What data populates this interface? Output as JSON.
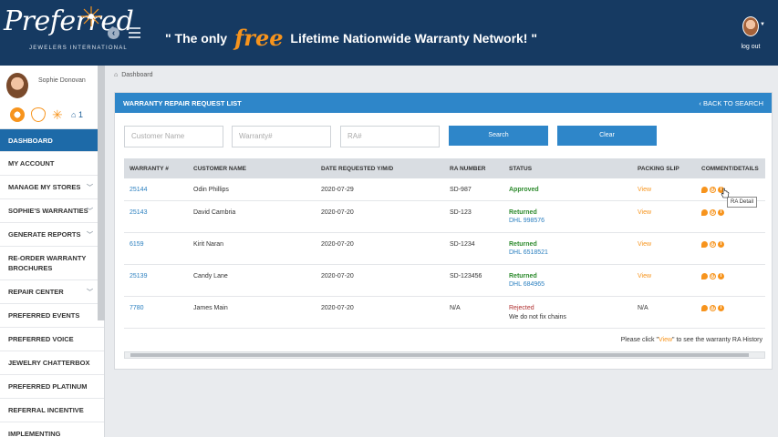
{
  "header": {
    "logo_word": "Preferred",
    "logo_sub": "JEWELERS INTERNATIONAL",
    "slogan_pre": "\" The only",
    "slogan_free": "free",
    "slogan_post": "Lifetime Nationwide Warranty Network! \"",
    "logout_label": "log out",
    "back_icon": "chevron-left-circle-icon",
    "menu_icon": "hamburger-icon"
  },
  "sidebar": {
    "user_name": "Sophie Donovan",
    "home_count": "1",
    "items": [
      {
        "label": "DASHBOARD",
        "active": true,
        "chevron": false
      },
      {
        "label": "MY ACCOUNT",
        "chevron": false
      },
      {
        "label": "MANAGE MY STORES",
        "chevron": true
      },
      {
        "label": "SOPHIE'S WARRANTIES",
        "chevron": true
      },
      {
        "label": "GENERATE REPORTS",
        "chevron": true
      },
      {
        "label": "RE-ORDER WARRANTY BROCHURES",
        "chevron": false
      },
      {
        "label": "REPAIR CENTER",
        "chevron": true
      },
      {
        "label": "PREFERRED EVENTS",
        "chevron": false
      },
      {
        "label": "PREFERRED VOICE",
        "chevron": false
      },
      {
        "label": "JEWELRY CHATTERBOX",
        "chevron": false
      },
      {
        "label": "PREFERRED PLATINUM",
        "chevron": false
      },
      {
        "label": "REFERRAL INCENTIVE",
        "chevron": false
      },
      {
        "label": "IMPLEMENTING",
        "chevron": false
      }
    ]
  },
  "breadcrumb": "Dashboard",
  "panel": {
    "title": "WARRANTY REPAIR REQUEST LIST",
    "back_label": "BACK TO SEARCH",
    "filters": {
      "customer_placeholder": "Customer Name",
      "warranty_placeholder": "Warranty#",
      "ra_placeholder": "RA#",
      "search_label": "Search",
      "clear_label": "Clear"
    },
    "columns": [
      "WARRANTY #",
      "CUSTOMER NAME",
      "DATE REQUESTED Y/M/D",
      "RA NUMBER",
      "STATUS",
      "PACKING SLIP",
      "COMMENT/DETAILS"
    ],
    "rows": [
      {
        "warranty": "25144",
        "customer": "Odin Phillips",
        "date": "2020-07-29",
        "ra": "SD-987",
        "status": "Approved",
        "status_type": "approved",
        "sub": "",
        "slip": "View"
      },
      {
        "warranty": "25143",
        "customer": "David Cambria",
        "date": "2020-07-20",
        "ra": "SD-123",
        "status": "Returned",
        "status_type": "returned",
        "sub": "DHL 998576",
        "slip": "View"
      },
      {
        "warranty": "6159",
        "customer": "Kirit Naran",
        "date": "2020-07-20",
        "ra": "SD-1234",
        "status": "Returned",
        "status_type": "returned",
        "sub": "DHL 6518521",
        "slip": "View"
      },
      {
        "warranty": "25139",
        "customer": "Candy Lane",
        "date": "2020-07-20",
        "ra": "SD-123456",
        "status": "Returned",
        "status_type": "returned",
        "sub": "DHL 684965",
        "slip": "View"
      },
      {
        "warranty": "7780",
        "customer": "James Main",
        "date": "2020-07-20",
        "ra": "N/A",
        "status": "Rejected",
        "status_type": "rejected",
        "sub": "We do not fix chains",
        "slip": "N/A"
      }
    ],
    "tooltip": "RA Detail",
    "note_pre": "Please click \"",
    "note_view": "View",
    "note_post": "\" to see the warranty RA History"
  },
  "colors": {
    "header_bg": "#163a62",
    "accent_orange": "#f7941d",
    "panel_head": "#2e86c9",
    "active_menu": "#1d6aa8"
  }
}
